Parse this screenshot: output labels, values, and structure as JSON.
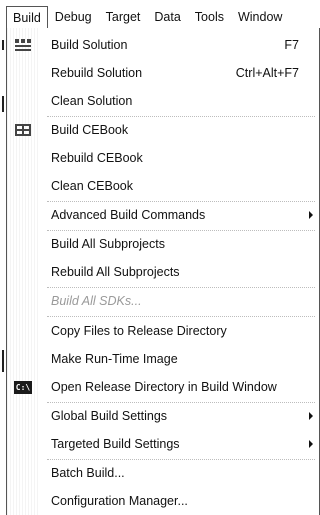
{
  "menubar": {
    "items": [
      {
        "label": "Build"
      },
      {
        "label": "Debug"
      },
      {
        "label": "Target"
      },
      {
        "label": "Data"
      },
      {
        "label": "Tools"
      },
      {
        "label": "Window"
      }
    ]
  },
  "build_menu": {
    "items": [
      {
        "label": "Build Solution",
        "shortcut": "F7",
        "icon": "build-icon"
      },
      {
        "label": "Rebuild Solution",
        "shortcut": "Ctrl+Alt+F7"
      },
      {
        "label": "Clean Solution"
      },
      {
        "label": "Build CEBook",
        "icon": "build-icon"
      },
      {
        "label": "Rebuild CEBook"
      },
      {
        "label": "Clean CEBook"
      },
      {
        "label": "Advanced Build Commands",
        "submenu": true
      },
      {
        "label": "Build All Subprojects"
      },
      {
        "label": "Rebuild All Subprojects"
      },
      {
        "label": "Build All SDKs...",
        "disabled": true
      },
      {
        "label": "Copy Files to Release Directory"
      },
      {
        "label": "Make Run-Time Image"
      },
      {
        "label": "Open Release Directory in Build Window",
        "icon": "console-icon",
        "icon_text": "C:\\"
      },
      {
        "label": "Global Build Settings",
        "submenu": true
      },
      {
        "label": "Targeted Build Settings",
        "submenu": true
      },
      {
        "label": "Batch Build..."
      },
      {
        "label": "Configuration Manager..."
      }
    ]
  }
}
